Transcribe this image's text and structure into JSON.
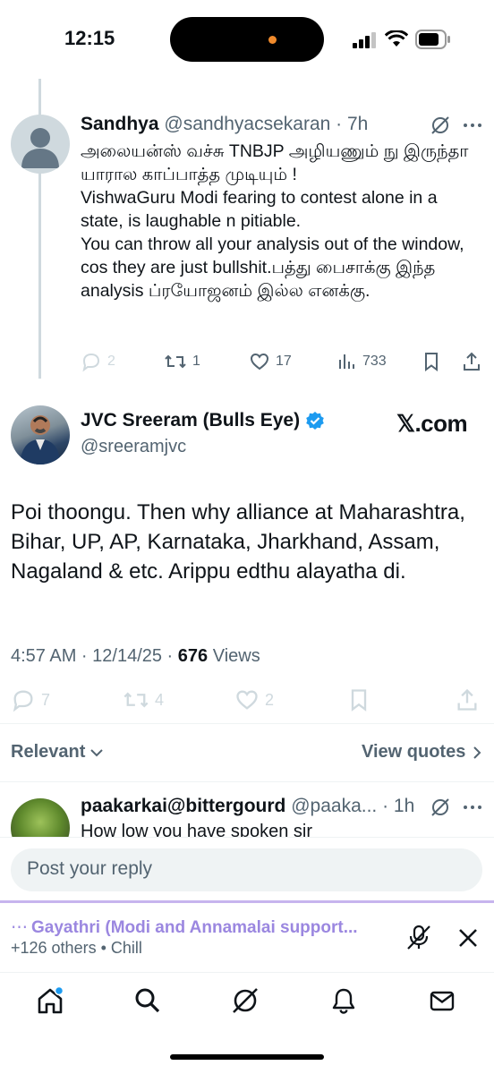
{
  "status_bar": {
    "time": "12:15"
  },
  "tweet1": {
    "name": "Sandhya",
    "handle": "@sandhyacsekaran",
    "age": "· 7h",
    "text": "அலையன்ஸ் வச்சு TNBJP  அழியணும் நு இருந்தா யாரால காப்பாத்த முடியும் !\nVishwaGuru Modi fearing to contest alone in a state, is laughable n pitiable.\nYou can throw all your analysis out of the window, cos they are just bullshit.பத்து பைசாக்கு இந்த analysis ப்ரயோஜனம் இல்ல எனக்கு.",
    "replies": "2",
    "reposts": "1",
    "likes": "17",
    "views": "733"
  },
  "main_tweet": {
    "name": "JVC Sreeram (Bulls Eye)",
    "handle": "@sreeramjvc",
    "watermark": "𝕏.com",
    "text": "Poi thoongu. Then why alliance at Maharashtra, Bihar, UP, AP, Karnataka, Jharkhand, Assam, Nagaland & etc. Arippu edthu alayatha di.",
    "timestamp": "4:57 AM · 12/14/25 · ",
    "views_count": "676",
    "views_label": " Views",
    "replies": "7",
    "reposts": "4",
    "likes": "2"
  },
  "sort": {
    "label": "Relevant",
    "view_quotes": "View quotes"
  },
  "reply_preview": {
    "name": "paakarkai@bittergourd",
    "handle": "@paaka...",
    "age": "· 1h",
    "text": "How low you have spoken sir"
  },
  "reply_input": {
    "placeholder": "Post your reply"
  },
  "space_bar": {
    "title": "Gayathri (Modi and Annamalai support...",
    "subtitle": "+126 others • Chill"
  },
  "colors": {
    "accent": "#1d9bf0",
    "space": "#9b87e0"
  },
  "nav": [
    "home-icon",
    "search-icon",
    "grok-icon",
    "notifications-icon",
    "messages-icon"
  ]
}
